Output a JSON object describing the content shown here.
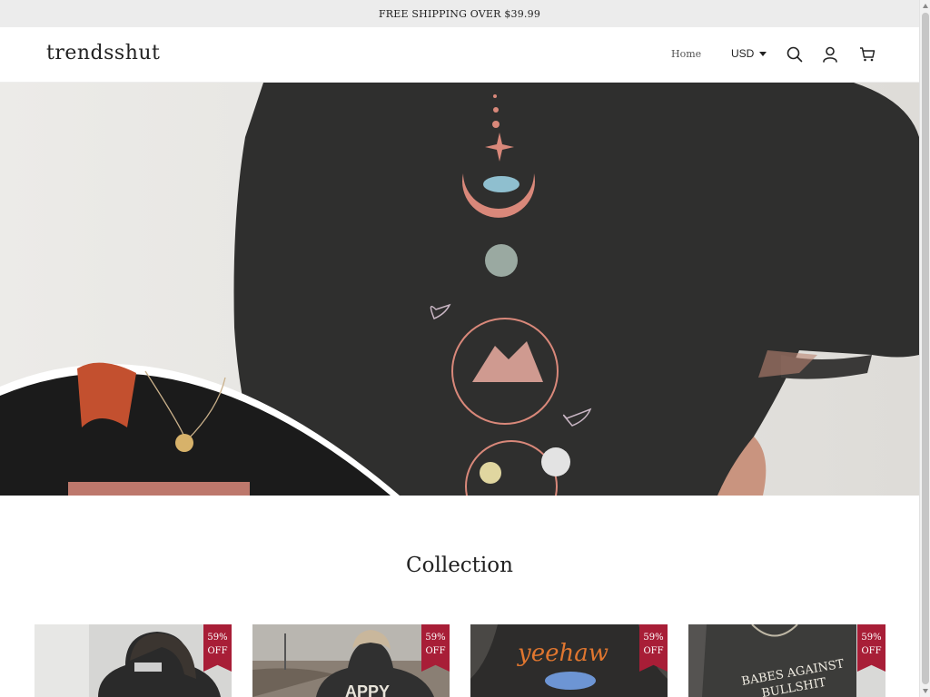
{
  "announcement": "FREE SHIPPING OVER $39.99",
  "header": {
    "logo": "trendsshut",
    "nav_home": "Home",
    "currency": "USD",
    "icons": [
      "search-icon",
      "account-icon",
      "cart-icon"
    ]
  },
  "hero": {
    "image": "black-oversized-tee-moon-phase-print"
  },
  "collection": {
    "title": "Collection",
    "products": [
      {
        "image": "woman-back-dark-tee",
        "discount_pct": "59%",
        "discount_label": "OFF"
      },
      {
        "image": "woman-back-desert-tee",
        "discount_pct": "59%",
        "discount_label": "OFF",
        "print_text": "APPY"
      },
      {
        "image": "yeehaw-print-tee",
        "discount_pct": "59%",
        "discount_label": "OFF",
        "print_text": "yeehaw"
      },
      {
        "image": "babes-against-tee",
        "discount_pct": "59%",
        "discount_label": "OFF",
        "print_text_1": "BABES AGAINST",
        "print_text_2": "BULLSHIT"
      }
    ]
  },
  "colors": {
    "announcement_bg": "#ececec",
    "badge": "#a81e37",
    "shirt": "#2f2f2e",
    "print_pink": "#d9887a"
  }
}
